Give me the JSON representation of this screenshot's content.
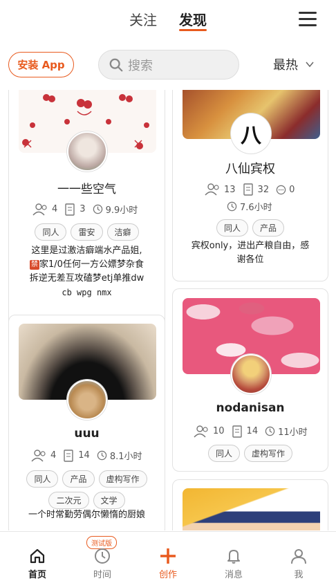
{
  "header": {
    "tabs": [
      {
        "label": "关注",
        "active": false
      },
      {
        "label": "发现",
        "active": true
      }
    ],
    "menu_icon": "hamburger-menu-icon"
  },
  "toolbar": {
    "install_label": "安装 App",
    "search_placeholder": "搜索",
    "sort_value": "最热"
  },
  "colors": {
    "accent": "#e85a1e",
    "tag_border": "#cccccc",
    "card_border": "#e2e2e2"
  },
  "cards": [
    {
      "title": "一一些空气",
      "members": "4",
      "posts": "3",
      "time": "9.9小时",
      "tags": [
        "同人",
        "雷安",
        "洁癖"
      ],
      "desc_lines": [
        "这里是过激洁癖端水产品姐,",
        "家1/0任何一方公嫖梦杂食",
        "拆逆无差互攻磕梦etj单推dw",
        "cb wpg nmx"
      ],
      "banned_label": "禁"
    },
    {
      "title": "八仙宾权",
      "avatar_text": "八",
      "members": "13",
      "posts": "32",
      "comments": "0",
      "time": "7.6小时",
      "tags": [
        "同人",
        "产品"
      ],
      "desc_lines": [
        "宾权only，进出产粮自由，感",
        "谢各位"
      ]
    },
    {
      "title": "uuu",
      "members": "4",
      "posts": "14",
      "time": "8.1小时",
      "tags": [
        "同人",
        "产品",
        "虚构写作",
        "二次元",
        "文学"
      ],
      "desc_lines": [
        "一个时常勤劳偶尔懒惰的厨娘"
      ]
    },
    {
      "title": "nodanisan",
      "members": "10",
      "posts": "14",
      "time": "11小时",
      "tags": [
        "同人",
        "虚构写作"
      ]
    }
  ],
  "bottom_nav": {
    "items": [
      {
        "label": "首页",
        "icon": "home-icon",
        "active": true
      },
      {
        "label": "时间",
        "icon": "clock-icon",
        "badge": "测试版"
      },
      {
        "label": "创作",
        "icon": "plus-icon"
      },
      {
        "label": "消息",
        "icon": "bell-icon"
      },
      {
        "label": "我",
        "icon": "user-icon"
      }
    ]
  }
}
